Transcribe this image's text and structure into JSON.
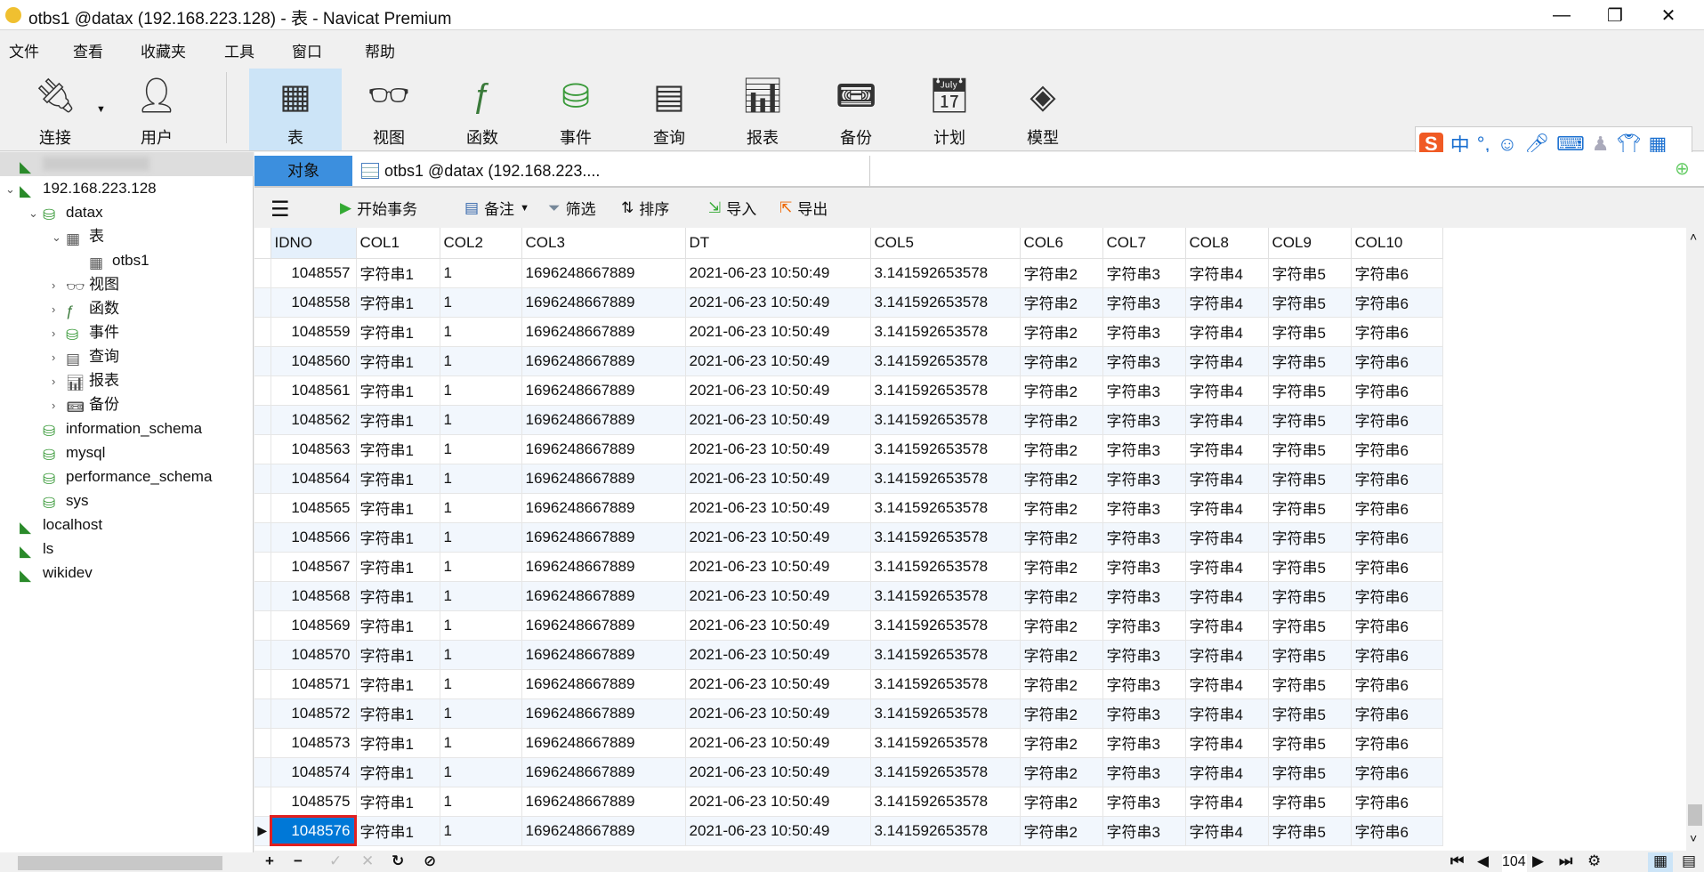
{
  "window": {
    "title": "otbs1 @datax (192.168.223.128) - 表 - Navicat Premium",
    "minimize": "—",
    "restore": "❐",
    "close": "✕"
  },
  "menu": [
    "文件",
    "查看",
    "收藏夹",
    "工具",
    "窗口",
    "帮助"
  ],
  "toolbar": [
    {
      "label": "连接",
      "icon": "connection-icon"
    },
    {
      "label": "用户",
      "icon": "user-icon"
    },
    {
      "label": "表",
      "icon": "table-icon",
      "active": true
    },
    {
      "label": "视图",
      "icon": "view-icon"
    },
    {
      "label": "函数",
      "icon": "function-icon"
    },
    {
      "label": "事件",
      "icon": "event-icon"
    },
    {
      "label": "查询",
      "icon": "query-icon"
    },
    {
      "label": "报表",
      "icon": "report-icon"
    },
    {
      "label": "备份",
      "icon": "backup-icon"
    },
    {
      "label": "计划",
      "icon": "schedule-icon"
    },
    {
      "label": "模型",
      "icon": "model-icon"
    }
  ],
  "tree": [
    {
      "label": "",
      "level": 0,
      "icon": "mysql-icon",
      "blurred": true
    },
    {
      "label": "192.168.223.128",
      "level": 0,
      "icon": "mysql-icon",
      "arrow": "v"
    },
    {
      "label": "datax",
      "level": 1,
      "icon": "database-icon",
      "arrow": "v"
    },
    {
      "label": "表",
      "level": 2,
      "icon": "table-icon",
      "arrow": "v"
    },
    {
      "label": "otbs1",
      "level": 3,
      "icon": "table-icon"
    },
    {
      "label": "视图",
      "level": 2,
      "icon": "view-icon",
      "arrow": ">"
    },
    {
      "label": "函数",
      "level": 2,
      "icon": "function-icon",
      "arrow": ">"
    },
    {
      "label": "事件",
      "level": 2,
      "icon": "event-icon",
      "arrow": ">"
    },
    {
      "label": "查询",
      "level": 2,
      "icon": "query-icon",
      "arrow": ">"
    },
    {
      "label": "报表",
      "level": 2,
      "icon": "report-icon",
      "arrow": ">"
    },
    {
      "label": "备份",
      "level": 2,
      "icon": "backup-icon",
      "arrow": ">"
    },
    {
      "label": "information_schema",
      "level": 1,
      "icon": "database-icon"
    },
    {
      "label": "mysql",
      "level": 1,
      "icon": "database-icon"
    },
    {
      "label": "performance_schema",
      "level": 1,
      "icon": "database-icon"
    },
    {
      "label": "sys",
      "level": 1,
      "icon": "database-icon"
    },
    {
      "label": "localhost",
      "level": 0,
      "icon": "mysql-icon"
    },
    {
      "label": "ls",
      "level": 0,
      "icon": "mysql-icon"
    },
    {
      "label": "wikidev",
      "level": 0,
      "icon": "mysql-icon"
    }
  ],
  "tabs": {
    "objects": "对象",
    "doc": "otbs1 @datax (192.168.223...."
  },
  "subtoolbar": {
    "begin_tx": "开始事务",
    "note": "备注",
    "filter": "筛选",
    "sort": "排序",
    "import": "导入",
    "export": "导出"
  },
  "ime": {
    "lang": "中",
    "punct": "°,"
  },
  "columns": [
    "IDNO",
    "COL1",
    "COL2",
    "COL3",
    "DT",
    "COL5",
    "COL6",
    "COL7",
    "COL8",
    "COL9",
    "COL10"
  ],
  "rows": [
    [
      "1048557",
      "字符串1",
      "1",
      "1696248667889",
      "2021-06-23 10:50:49",
      "3.141592653578",
      "字符串2",
      "字符串3",
      "字符串4",
      "字符串5",
      "字符串6"
    ],
    [
      "1048558",
      "字符串1",
      "1",
      "1696248667889",
      "2021-06-23 10:50:49",
      "3.141592653578",
      "字符串2",
      "字符串3",
      "字符串4",
      "字符串5",
      "字符串6"
    ],
    [
      "1048559",
      "字符串1",
      "1",
      "1696248667889",
      "2021-06-23 10:50:49",
      "3.141592653578",
      "字符串2",
      "字符串3",
      "字符串4",
      "字符串5",
      "字符串6"
    ],
    [
      "1048560",
      "字符串1",
      "1",
      "1696248667889",
      "2021-06-23 10:50:49",
      "3.141592653578",
      "字符串2",
      "字符串3",
      "字符串4",
      "字符串5",
      "字符串6"
    ],
    [
      "1048561",
      "字符串1",
      "1",
      "1696248667889",
      "2021-06-23 10:50:49",
      "3.141592653578",
      "字符串2",
      "字符串3",
      "字符串4",
      "字符串5",
      "字符串6"
    ],
    [
      "1048562",
      "字符串1",
      "1",
      "1696248667889",
      "2021-06-23 10:50:49",
      "3.141592653578",
      "字符串2",
      "字符串3",
      "字符串4",
      "字符串5",
      "字符串6"
    ],
    [
      "1048563",
      "字符串1",
      "1",
      "1696248667889",
      "2021-06-23 10:50:49",
      "3.141592653578",
      "字符串2",
      "字符串3",
      "字符串4",
      "字符串5",
      "字符串6"
    ],
    [
      "1048564",
      "字符串1",
      "1",
      "1696248667889",
      "2021-06-23 10:50:49",
      "3.141592653578",
      "字符串2",
      "字符串3",
      "字符串4",
      "字符串5",
      "字符串6"
    ],
    [
      "1048565",
      "字符串1",
      "1",
      "1696248667889",
      "2021-06-23 10:50:49",
      "3.141592653578",
      "字符串2",
      "字符串3",
      "字符串4",
      "字符串5",
      "字符串6"
    ],
    [
      "1048566",
      "字符串1",
      "1",
      "1696248667889",
      "2021-06-23 10:50:49",
      "3.141592653578",
      "字符串2",
      "字符串3",
      "字符串4",
      "字符串5",
      "字符串6"
    ],
    [
      "1048567",
      "字符串1",
      "1",
      "1696248667889",
      "2021-06-23 10:50:49",
      "3.141592653578",
      "字符串2",
      "字符串3",
      "字符串4",
      "字符串5",
      "字符串6"
    ],
    [
      "1048568",
      "字符串1",
      "1",
      "1696248667889",
      "2021-06-23 10:50:49",
      "3.141592653578",
      "字符串2",
      "字符串3",
      "字符串4",
      "字符串5",
      "字符串6"
    ],
    [
      "1048569",
      "字符串1",
      "1",
      "1696248667889",
      "2021-06-23 10:50:49",
      "3.141592653578",
      "字符串2",
      "字符串3",
      "字符串4",
      "字符串5",
      "字符串6"
    ],
    [
      "1048570",
      "字符串1",
      "1",
      "1696248667889",
      "2021-06-23 10:50:49",
      "3.141592653578",
      "字符串2",
      "字符串3",
      "字符串4",
      "字符串5",
      "字符串6"
    ],
    [
      "1048571",
      "字符串1",
      "1",
      "1696248667889",
      "2021-06-23 10:50:49",
      "3.141592653578",
      "字符串2",
      "字符串3",
      "字符串4",
      "字符串5",
      "字符串6"
    ],
    [
      "1048572",
      "字符串1",
      "1",
      "1696248667889",
      "2021-06-23 10:50:49",
      "3.141592653578",
      "字符串2",
      "字符串3",
      "字符串4",
      "字符串5",
      "字符串6"
    ],
    [
      "1048573",
      "字符串1",
      "1",
      "1696248667889",
      "2021-06-23 10:50:49",
      "3.141592653578",
      "字符串2",
      "字符串3",
      "字符串4",
      "字符串5",
      "字符串6"
    ],
    [
      "1048574",
      "字符串1",
      "1",
      "1696248667889",
      "2021-06-23 10:50:49",
      "3.141592653578",
      "字符串2",
      "字符串3",
      "字符串4",
      "字符串5",
      "字符串6"
    ],
    [
      "1048575",
      "字符串1",
      "1",
      "1696248667889",
      "2021-06-23 10:50:49",
      "3.141592653578",
      "字符串2",
      "字符串3",
      "字符串4",
      "字符串5",
      "字符串6"
    ],
    [
      "1048576",
      "字符串1",
      "1",
      "1696248667889",
      "2021-06-23 10:50:49",
      "3.141592653578",
      "字符串2",
      "字符串3",
      "字符串4",
      "字符串5",
      "字符串6"
    ]
  ],
  "selected_row": 19,
  "pager": {
    "page": "104"
  },
  "colors": {
    "accent": "#0078d7",
    "tab_active": "#3c8fde",
    "selection_border": "#e02020",
    "toolbar_active": "#cce4f7"
  }
}
